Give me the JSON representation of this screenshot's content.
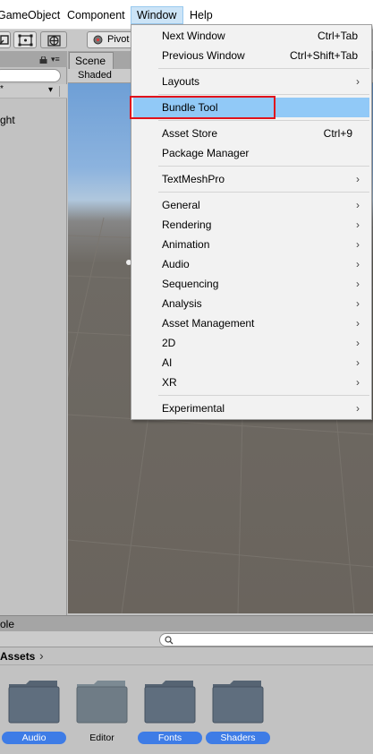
{
  "menubar": {
    "items": [
      {
        "label": "GameObject"
      },
      {
        "label": "Component"
      },
      {
        "label": "Window"
      },
      {
        "label": "Help"
      }
    ]
  },
  "toolbar": {
    "pivot_label": "Pivot"
  },
  "hierarchy": {
    "row_prefix": "*",
    "item_partial": "ght"
  },
  "scene": {
    "tab_label": "Scene",
    "shading_mode": "Shaded"
  },
  "bottom": {
    "console_partial": "ole",
    "breadcrumb": "Assets",
    "folders": [
      {
        "label": "Audio",
        "selected": true
      },
      {
        "label": "Editor",
        "selected": false
      },
      {
        "label": "Fonts",
        "selected": true
      },
      {
        "label": "Shaders",
        "selected": true
      }
    ]
  },
  "window_menu": {
    "items": [
      {
        "label": "Next Window",
        "shortcut": "Ctrl+Tab"
      },
      {
        "label": "Previous Window",
        "shortcut": "Ctrl+Shift+Tab"
      },
      {
        "label": "Layouts",
        "submenu": true
      },
      {
        "label": "Bundle Tool",
        "highlighted": true
      },
      {
        "label": "Asset Store",
        "shortcut": "Ctrl+9"
      },
      {
        "label": "Package Manager"
      },
      {
        "label": "TextMeshPro",
        "submenu": true
      },
      {
        "label": "General",
        "submenu": true
      },
      {
        "label": "Rendering",
        "submenu": true
      },
      {
        "label": "Animation",
        "submenu": true
      },
      {
        "label": "Audio",
        "submenu": true
      },
      {
        "label": "Sequencing",
        "submenu": true
      },
      {
        "label": "Analysis",
        "submenu": true
      },
      {
        "label": "Asset Management",
        "submenu": true
      },
      {
        "label": "2D",
        "submenu": true
      },
      {
        "label": "AI",
        "submenu": true
      },
      {
        "label": "XR",
        "submenu": true
      },
      {
        "label": "Experimental",
        "submenu": true
      }
    ],
    "submenu_glyph": "›"
  },
  "colors": {
    "menu_highlight": "#91c9f7",
    "annotation_box": "#e0121b",
    "folder_selected": "#3e7ce6"
  }
}
